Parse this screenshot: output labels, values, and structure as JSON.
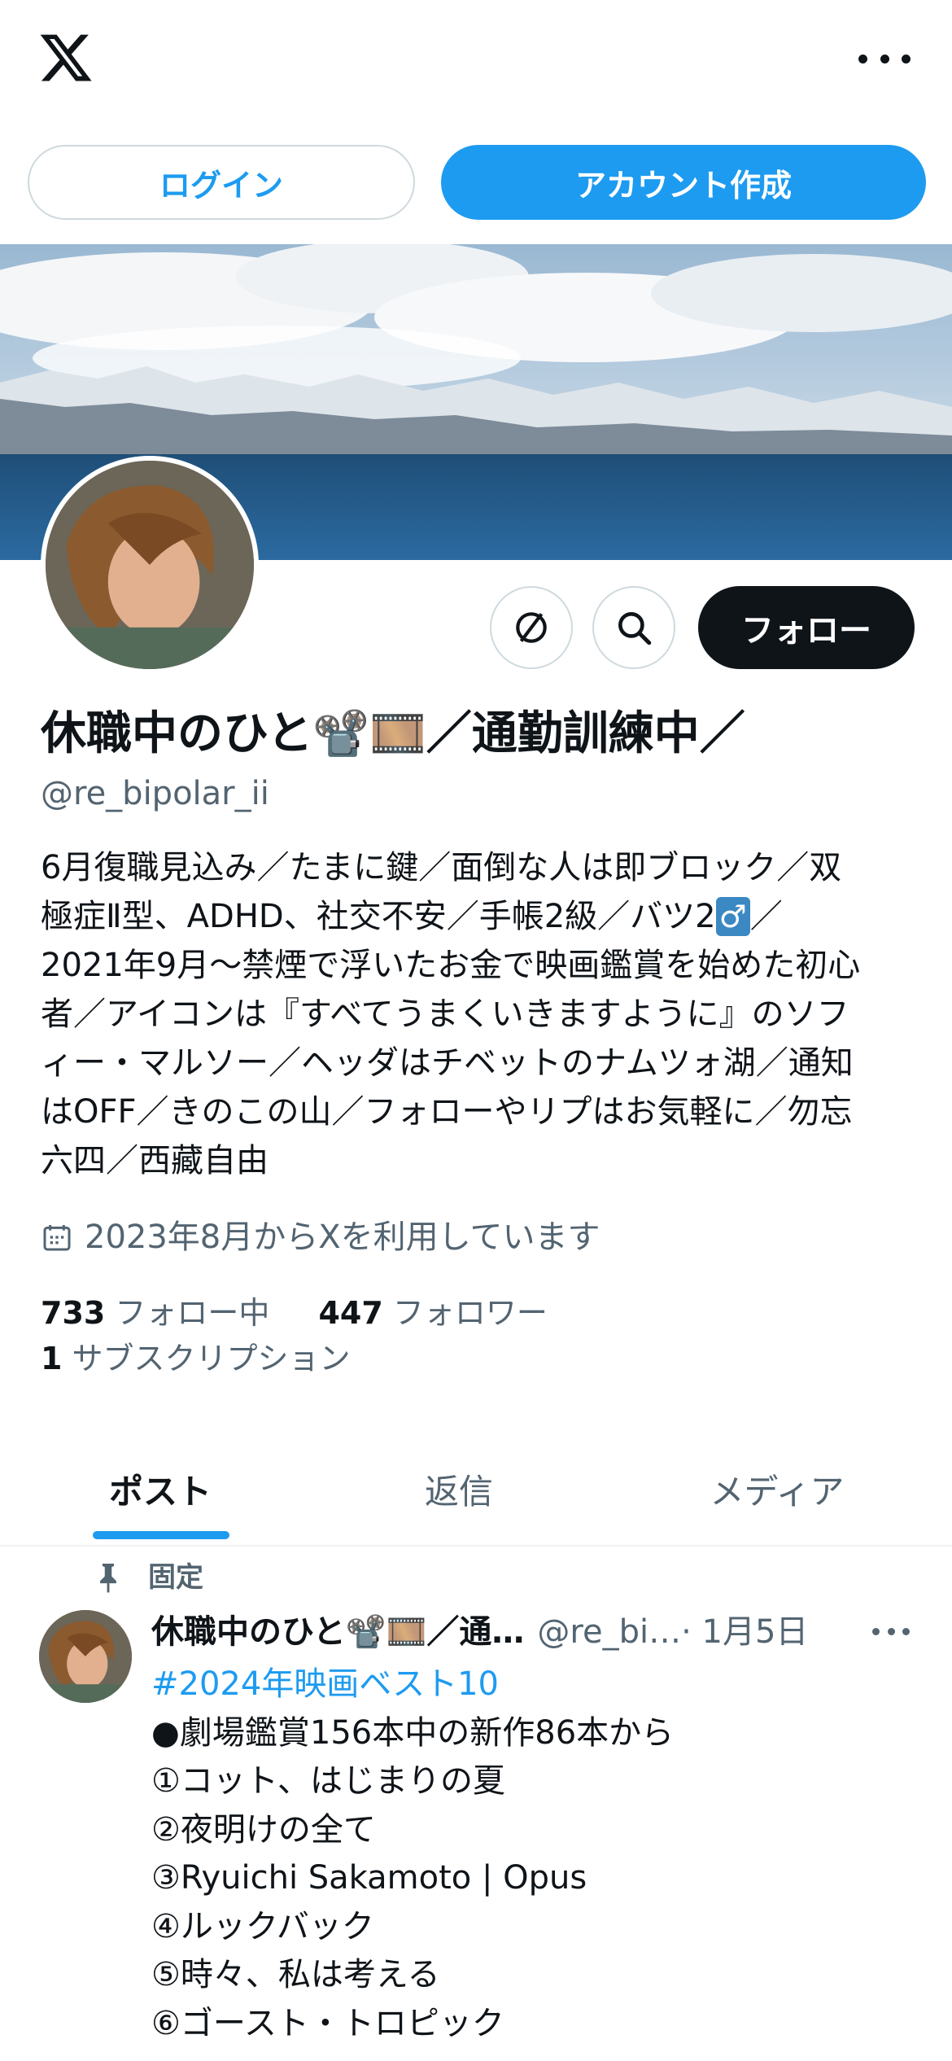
{
  "header": {
    "logo_icon": "x-logo-icon",
    "more_icon": "more-horizontal-icon"
  },
  "auth": {
    "login_label": "ログイン",
    "signup_label": "アカウント作成"
  },
  "profile": {
    "display_name": "休職中のひと📽️🎞️／通勤訓練中／",
    "handle": "@re_bipolar_ii",
    "follow_label": "フォロー",
    "bio_lines": [
      "6月復職見込み／たまに鍵／面倒な人は即ブロック／双",
      "極症Ⅱ型、ADHD、社交不安／手帳2級／バツ2",
      "2021年9月〜禁煙で浮いたお金で映画鑑賞を始めた初心",
      "者／アイコンは『すべてうまくいきますように』のソフ",
      "ィー・マルソー／ヘッダはチベットのナムツォ湖／通知",
      "はOFF／きのこの山／フォローやリプはお気軽に／勿忘",
      "六四／西藏自由"
    ],
    "bio_line2_badge": "♂",
    "bio_line2_tail": "／",
    "joined": "2023年8月からXを利用しています",
    "following_count": "733",
    "following_label": "フォロー中",
    "followers_count": "447",
    "followers_label": "フォロワー",
    "subs_count": "1",
    "subs_label": "サブスクリプション"
  },
  "tabs": [
    {
      "label": "ポスト",
      "active": true
    },
    {
      "label": "返信",
      "active": false
    },
    {
      "label": "メディア",
      "active": false
    }
  ],
  "pinned_post": {
    "pinned_label": "固定",
    "author_name": "休職中のひと📽️🎞️／通…",
    "author_handle": "@re_bi…",
    "date": " · 1月5日",
    "lines": [
      "#2024年映画ベスト10",
      "●劇場鑑賞156本中の新作86本から",
      "①コット、はじまりの夏",
      "②夜明けの全て",
      "③Ryuichi Sakamoto | Opus",
      "④ルックバック",
      "⑤時々、私は考える",
      "⑥ゴースト・トロピック"
    ]
  },
  "colors": {
    "accent": "#1d9bf0",
    "text_primary": "#0f1419",
    "text_secondary": "#536471",
    "border": "#cfd9de"
  }
}
